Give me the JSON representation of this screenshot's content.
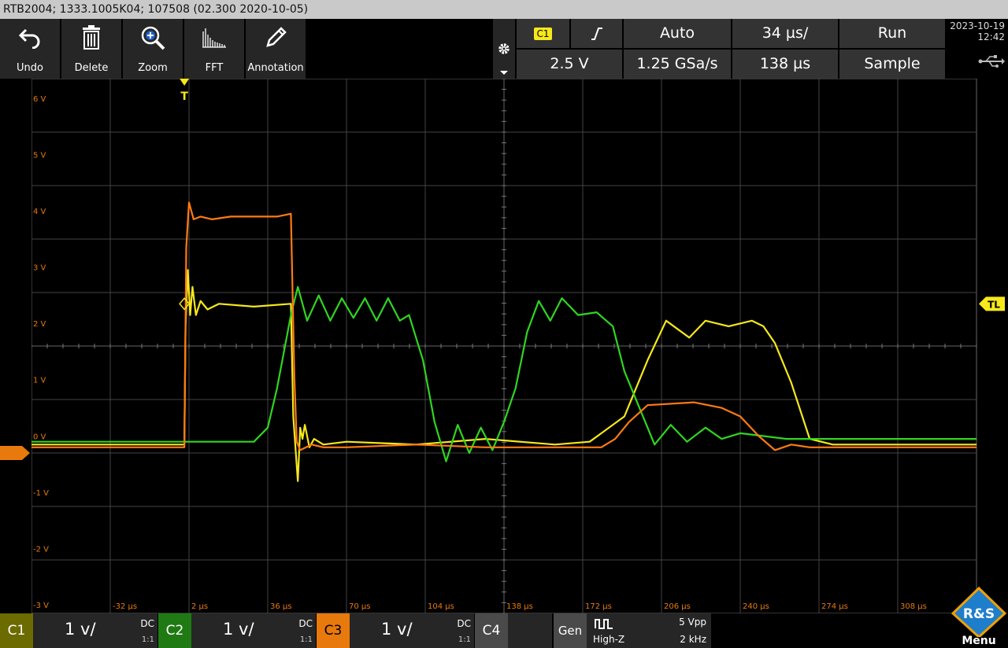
{
  "title": "RTB2004; 1333.1005K04; 107508 (02.300 2020-10-05)",
  "toolbar": [
    {
      "label": "Undo",
      "icon": "undo-icon"
    },
    {
      "label": "Delete",
      "icon": "trash-icon"
    },
    {
      "label": "Zoom",
      "icon": "zoom-icon"
    },
    {
      "label": "FFT",
      "icon": "fft-icon"
    },
    {
      "label": "Annotation",
      "icon": "pencil-icon"
    }
  ],
  "settings": {
    "trigger_source": "C1",
    "trigger_edge": "rising-edge-icon",
    "trigger_mode": "Auto",
    "time_div": "34 µs/",
    "run_state": "Run",
    "trigger_level": "2.5 V",
    "sample_rate": "1.25 GSa/s",
    "record_length": "138 µs",
    "acq_mode": "Sample"
  },
  "datetime": {
    "date": "2023-10-19",
    "time": "12:42"
  },
  "chart_data": {
    "type": "line",
    "y_ticks": [
      "6 V",
      "5 V",
      "4 V",
      "3 V",
      "2 V",
      "1 V",
      "0 V",
      "-1 V",
      "-2 V",
      "-3 V"
    ],
    "x_ticks": [
      "-32 µs",
      "2 µs",
      "36 µs",
      "70 µs",
      "104 µs",
      "138 µs",
      "172 µs",
      "206 µs",
      "240 µs",
      "274 µs",
      "308 µs"
    ],
    "xlim": [
      -66,
      342
    ],
    "ylim": [
      -3,
      6.5
    ],
    "grid": true,
    "trigger_marker": "T",
    "trigger_level_marker": "TL",
    "ground_marker": "C3",
    "series": [
      {
        "name": "C1",
        "color": "#f6e81b",
        "x": [
          -66,
          0,
          0.5,
          1.5,
          2.5,
          3.5,
          5,
          7,
          10,
          15,
          30,
          46,
          47,
          49,
          50,
          51,
          52,
          54,
          56,
          60,
          70,
          100,
          130,
          160,
          175,
          190,
          200,
          208,
          218,
          225,
          235,
          245,
          250,
          255,
          262,
          270,
          280,
          300,
          342
        ],
        "y": [
          0,
          0,
          2.1,
          3.1,
          2.3,
          2.8,
          2.3,
          2.55,
          2.4,
          2.5,
          2.45,
          2.5,
          0.5,
          -0.65,
          0.3,
          0.1,
          0.35,
          -0.05,
          0.1,
          0,
          0.05,
          0,
          0.1,
          0,
          0.05,
          0.5,
          1.5,
          2.2,
          1.9,
          2.2,
          2.1,
          2.2,
          2.1,
          1.8,
          1.1,
          0.1,
          0,
          0,
          0
        ]
      },
      {
        "name": "C2",
        "color": "#2fd620",
        "x": [
          -66,
          30,
          36,
          40,
          46,
          49,
          53,
          58,
          63,
          68,
          73,
          78,
          83,
          88,
          93,
          97,
          103,
          108,
          113,
          118,
          123,
          128,
          133,
          138,
          143,
          148,
          153,
          158,
          163,
          170,
          178,
          185,
          190,
          197,
          203,
          210,
          217,
          225,
          232,
          240,
          260,
          342
        ],
        "y": [
          0.05,
          0.05,
          0.3,
          1.0,
          2.3,
          2.8,
          2.2,
          2.65,
          2.2,
          2.6,
          2.25,
          2.6,
          2.2,
          2.6,
          2.2,
          2.3,
          1.5,
          0.4,
          -0.3,
          0.35,
          -0.15,
          0.3,
          -0.1,
          0.4,
          1.0,
          2.0,
          2.55,
          2.2,
          2.6,
          2.3,
          2.35,
          2.1,
          1.3,
          0.6,
          0,
          0.35,
          0.05,
          0.3,
          0.1,
          0.2,
          0.1,
          0.1
        ]
      },
      {
        "name": "C3",
        "color": "#ff7a12",
        "x": [
          -66,
          0,
          0.8,
          2,
          4,
          7,
          12,
          20,
          40,
          46,
          47.5,
          48.5,
          50,
          55,
          60,
          70,
          100,
          130,
          150,
          160,
          170,
          180,
          186,
          192,
          200,
          220,
          232,
          240,
          248,
          255,
          262,
          270,
          280,
          342
        ],
        "y": [
          -0.05,
          -0.05,
          3.5,
          4.3,
          4.0,
          4.05,
          4.0,
          4.05,
          4.05,
          4.1,
          1.2,
          0.05,
          -0.1,
          0,
          -0.05,
          -0.05,
          0,
          -0.05,
          -0.05,
          -0.05,
          -0.05,
          -0.05,
          0.1,
          0.4,
          0.7,
          0.75,
          0.65,
          0.5,
          0.15,
          -0.1,
          0,
          -0.05,
          -0.05,
          -0.05
        ]
      }
    ]
  },
  "channels": [
    {
      "name": "C1",
      "scale": "1 v/",
      "coupling": "DC",
      "probe": "1:1",
      "color": "#6b6b00"
    },
    {
      "name": "C2",
      "scale": "1 v/",
      "coupling": "DC",
      "probe": "1:1",
      "color": "#1f7a14"
    },
    {
      "name": "C3",
      "scale": "1 v/",
      "coupling": "DC",
      "probe": "1:1",
      "color": "#e8790c"
    },
    {
      "name": "C4",
      "color": "#4a4a4a"
    }
  ],
  "generator": {
    "label": "Gen",
    "waveform": "square-wave-icon",
    "impedance": "High-Z",
    "amplitude": "5 Vpp",
    "frequency": "2 kHz"
  },
  "menu_label": "Menu",
  "logo_text": "R&S"
}
